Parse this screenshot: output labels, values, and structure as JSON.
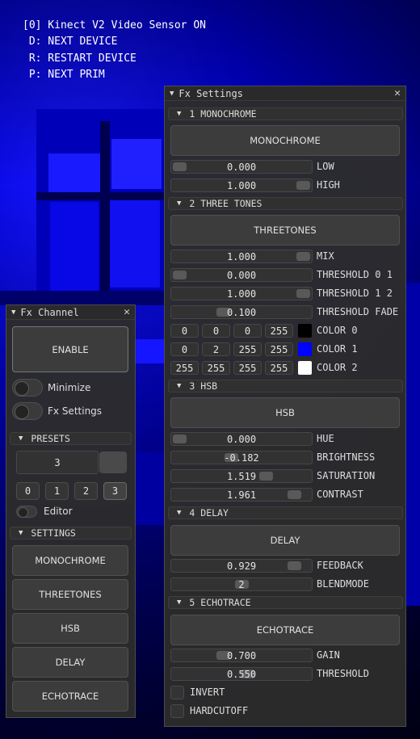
{
  "osd": {
    "lines": [
      "[0] Kinect V2 Video Sensor ON",
      " D: NEXT DEVICE",
      " R: RESTART DEVICE",
      " P: NEXT PRIM"
    ]
  },
  "fx_settings": {
    "title": "Fx Settings",
    "sections": {
      "s1": {
        "title": "1 MONOCHROME",
        "button": "MONOCHROME",
        "low": {
          "value": "0.000",
          "label": "LOW",
          "level": 0.0
        },
        "high": {
          "value": "1.000",
          "label": "HIGH",
          "level": 1.0
        }
      },
      "s2": {
        "title": "2 THREE TONES",
        "button": "THREETONES",
        "mix": {
          "value": "1.000",
          "label": "MIX",
          "level": 1.0
        },
        "th01": {
          "value": "0.000",
          "label": "THRESHOLD 0 1",
          "level": 0.0
        },
        "th12": {
          "value": "1.000",
          "label": "THRESHOLD 1 2",
          "level": 1.0
        },
        "fade": {
          "value": "0.100",
          "label": "THRESHOLD FADE",
          "level": 0.35
        },
        "color0": {
          "label": "COLOR 0",
          "r": "0",
          "g": "0",
          "b": "0",
          "a": "255",
          "hex": "#000000"
        },
        "color1": {
          "label": "COLOR 1",
          "r": "0",
          "g": "2",
          "b": "255",
          "a": "255",
          "hex": "#0002ff"
        },
        "color2": {
          "label": "COLOR 2",
          "r": "255",
          "g": "255",
          "b": "255",
          "a": "255",
          "hex": "#ffffff"
        }
      },
      "s3": {
        "title": "3 HSB",
        "button": "HSB",
        "hue": {
          "value": "0.000",
          "label": "HUE",
          "level": 0.0
        },
        "brightness": {
          "value": "-0.182",
          "label": "BRIGHTNESS",
          "level": 0.42
        },
        "saturation": {
          "value": "1.519",
          "label": "SATURATION",
          "level": 0.7
        },
        "contrast": {
          "value": "1.961",
          "label": "CONTRAST",
          "level": 0.93
        }
      },
      "s4": {
        "title": "4 DELAY",
        "button": "DELAY",
        "feedback": {
          "value": "0.929",
          "label": "FEEDBACK",
          "level": 0.93
        },
        "blendmode": {
          "value": "2",
          "label": "BLENDMODE",
          "level": 0.5
        }
      },
      "s5": {
        "title": "5 ECHOTRACE",
        "button": "ECHOTRACE",
        "gain": {
          "value": "0.700",
          "label": "GAIN",
          "level": 0.35
        },
        "threshold": {
          "value": "0.550",
          "label": "THRESHOLD",
          "level": 0.55
        },
        "invert": {
          "label": "INVERT",
          "checked": false
        },
        "hardcutoff": {
          "label": "HARDCUTOFF",
          "checked": false
        }
      }
    }
  },
  "fx_channel": {
    "title": "Fx Channel",
    "enable_label": "ENABLE",
    "minimize_label": "Minimize",
    "fx_settings_label": "Fx Settings",
    "presets": {
      "title": "PRESETS",
      "value": "3",
      "buttons": [
        "0",
        "1",
        "2",
        "3"
      ],
      "selected": "3",
      "editor_label": "Editor"
    },
    "settings": {
      "title": "SETTINGS",
      "buttons": [
        "MONOCHROME",
        "THREETONES",
        "HSB",
        "DELAY",
        "ECHOTRACE"
      ]
    }
  },
  "colors": {
    "background": "#0000d8",
    "panel": "#2c2c2c"
  }
}
